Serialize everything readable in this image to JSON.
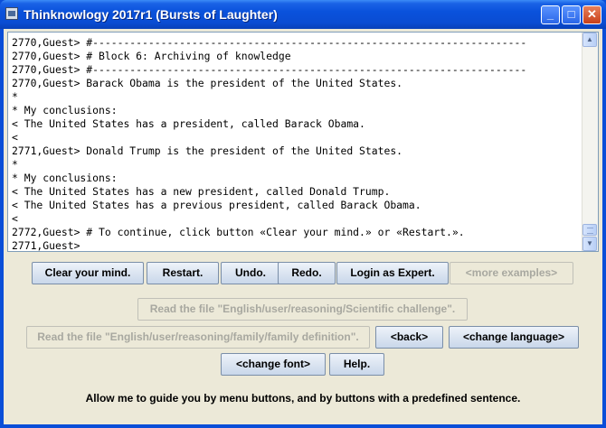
{
  "window": {
    "title": "Thinknowlogy 2017r1 (Bursts of Laughter)",
    "controls": {
      "minimize": "_",
      "maximize": "□",
      "close": "✕"
    }
  },
  "console": {
    "lines": [
      "2770,Guest> #----------------------------------------------------------------------",
      "2770,Guest> # Block 6: Archiving of knowledge",
      "2770,Guest> #----------------------------------------------------------------------",
      "2770,Guest> Barack Obama is the president of the United States.",
      "*",
      "* My conclusions:",
      "< The United States has a president, called Barack Obama.",
      "<",
      "2771,Guest> Donald Trump is the president of the United States.",
      "*",
      "* My conclusions:",
      "< The United States has a new president, called Donald Trump.",
      "< The United States has a previous president, called Barack Obama.",
      "<",
      "2772,Guest> # To continue, click button «Clear your mind.» or «Restart.».",
      "2771,Guest>"
    ],
    "scrollbar": {
      "up": "▲",
      "down": "▼"
    }
  },
  "buttons": {
    "clear": "Clear your mind.",
    "restart": "Restart.",
    "undo": "Undo.",
    "redo": "Redo.",
    "login": "Login as Expert.",
    "more_examples": "<more examples>",
    "read_scientific": "Read the file \"English/user/reasoning/Scientific challenge\".",
    "read_family": "Read the file \"English/user/reasoning/family/family definition\".",
    "back": "<back>",
    "change_language": "<change language>",
    "change_font": "<change font>",
    "help": "Help."
  },
  "footer": {
    "text": "Allow me to guide you by menu buttons, and by buttons with a predefined sentence."
  }
}
